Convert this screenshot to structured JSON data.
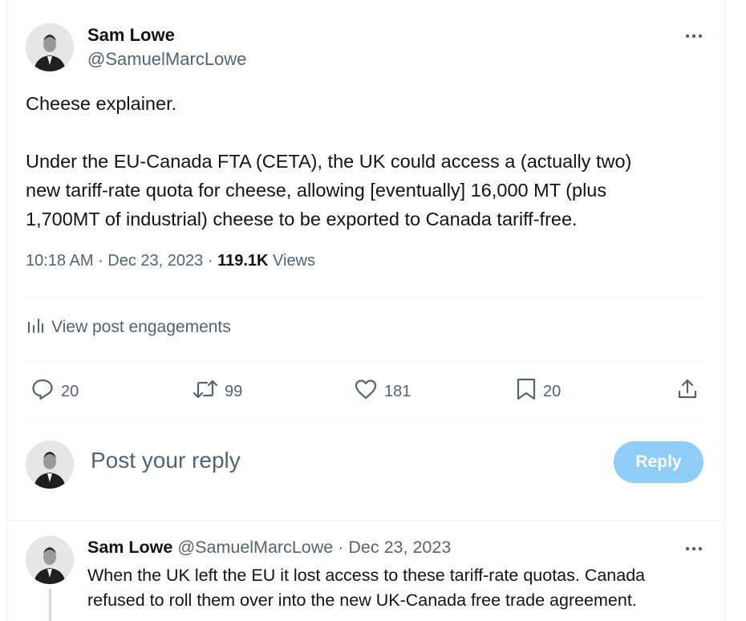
{
  "tweet": {
    "author_name": "Sam Lowe",
    "author_handle": "@SamuelMarcLowe",
    "text_lines": [
      "Cheese explainer.",
      "",
      "Under the EU-Canada FTA (CETA), the UK could access a (actually two)",
      "new tariff-rate quota for cheese, allowing [eventually] 16,000 MT (plus",
      "1,700MT of industrial) cheese to be exported to Canada tariff-free."
    ],
    "time": "10:18 AM",
    "date": "Dec 23, 2023",
    "views_count": "119.1K",
    "views_label": "Views",
    "engagements_label": "View post engagements",
    "actions": {
      "replies": "20",
      "reposts": "99",
      "likes": "181",
      "bookmarks": "20"
    }
  },
  "reply_box": {
    "placeholder": "Post your reply",
    "button_label": "Reply"
  },
  "thread_reply": {
    "author_name": "Sam Lowe",
    "author_handle": "@SamuelMarcLowe",
    "date": "Dec 23, 2023",
    "text_lines": [
      "When the UK left the EU it lost access to these tariff-rate quotas. Canada",
      "refused to roll them over into the new UK-Canada free trade agreement."
    ]
  },
  "colors": {
    "text": "#0f1419",
    "secondary": "#536471",
    "divider": "#eff3f4",
    "reply_button_disabled": "#8ecdf8"
  },
  "icons": [
    "more-icon",
    "analytics-icon",
    "reply-icon",
    "repost-icon",
    "like-icon",
    "bookmark-icon",
    "share-icon"
  ]
}
